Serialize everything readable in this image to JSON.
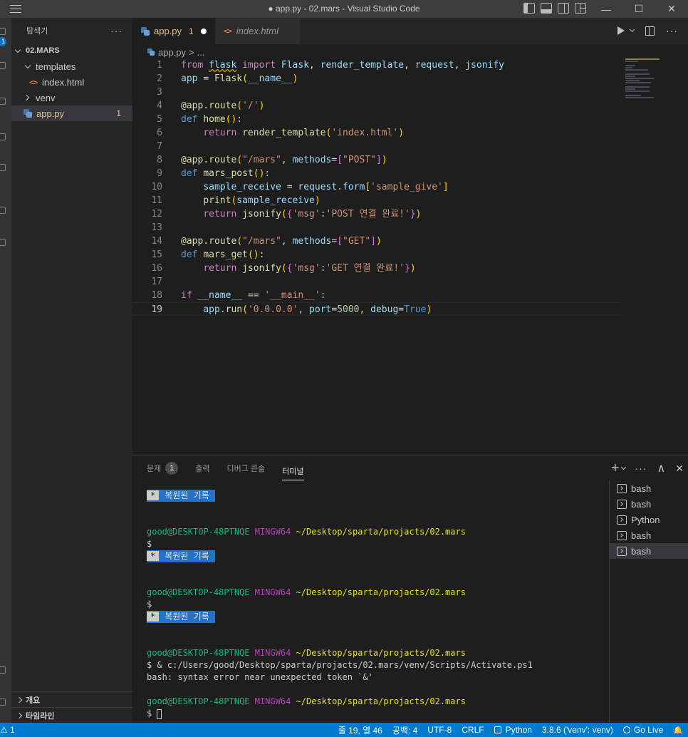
{
  "window": {
    "title": "● app.py - 02.mars - Visual Studio Code",
    "close": "✕",
    "maximize": "☐",
    "minimize": "—"
  },
  "activity": {
    "badge": "1"
  },
  "sidebar": {
    "title": "탐색기",
    "more": "···",
    "root": "02.MARS",
    "items": [
      {
        "label": "templates",
        "kind": "folder-open"
      },
      {
        "label": "index.html",
        "kind": "html"
      },
      {
        "label": "venv",
        "kind": "folder-closed"
      },
      {
        "label": "app.py",
        "kind": "python",
        "problems": "1"
      }
    ],
    "sections": [
      "개요",
      "타임라인"
    ]
  },
  "tabs": [
    {
      "label": "app.py",
      "problems": "1",
      "dirty": true
    },
    {
      "label": "index.html"
    }
  ],
  "breadcrumb": {
    "file": "app.py",
    "sep": ">",
    "more": "..."
  },
  "editor": {
    "current_line": 19,
    "lines": [
      "from flask import Flask, render_template, request, jsonify",
      "app = Flask(__name__)",
      "",
      "@app.route('/')",
      "def home():",
      "    return render_template('index.html')",
      "",
      "@app.route(\"/mars\", methods=[\"POST\"])",
      "def mars_post():",
      "    sample_receive = request.form['sample_give']",
      "    print(sample_receive)",
      "    return jsonify({'msg':'POST 연결 완료!'})",
      "",
      "@app.route(\"/mars\", methods=[\"GET\"])",
      "def mars_get():",
      "    return jsonify({'msg':'GET 연결 완료!'})",
      "",
      "if __name__ == '__main__':",
      "    app.run('0.0.0.0', port=5000, debug=True)"
    ]
  },
  "panel": {
    "tabs": [
      {
        "label": "문제",
        "badge": "1"
      },
      {
        "label": "출력"
      },
      {
        "label": "디버그 콘솔"
      },
      {
        "label": "터미널",
        "active": true
      }
    ],
    "actions": {
      "add": "+",
      "more": "···",
      "maximize": "∧",
      "close": "✕"
    },
    "terminal": {
      "restored_star": "*",
      "restored_text": "복원된 기록",
      "user": "good@DESKTOP-48PTNQE",
      "host": "MINGW64",
      "path": "~/Desktop/sparta/projacts/02.mars",
      "prompt": "$",
      "command": "$ & c:/Users/good/Desktop/sparta/projacts/02.mars/venv/Scripts/Activate.ps1",
      "error": "bash: syntax error near unexpected token `&'"
    },
    "instances": [
      {
        "label": "bash"
      },
      {
        "label": "bash"
      },
      {
        "label": "Python"
      },
      {
        "label": "bash"
      },
      {
        "label": "bash",
        "selected": true
      }
    ]
  },
  "status": {
    "problems": "⚠ 1",
    "position": "줄 19, 열 46",
    "spaces": "공백: 4",
    "encoding": "UTF-8",
    "eol": "CRLF",
    "language": "Python",
    "interpreter": "3.8.6 ('venv': venv)",
    "golive": "Go Live",
    "bell": "🔔"
  }
}
